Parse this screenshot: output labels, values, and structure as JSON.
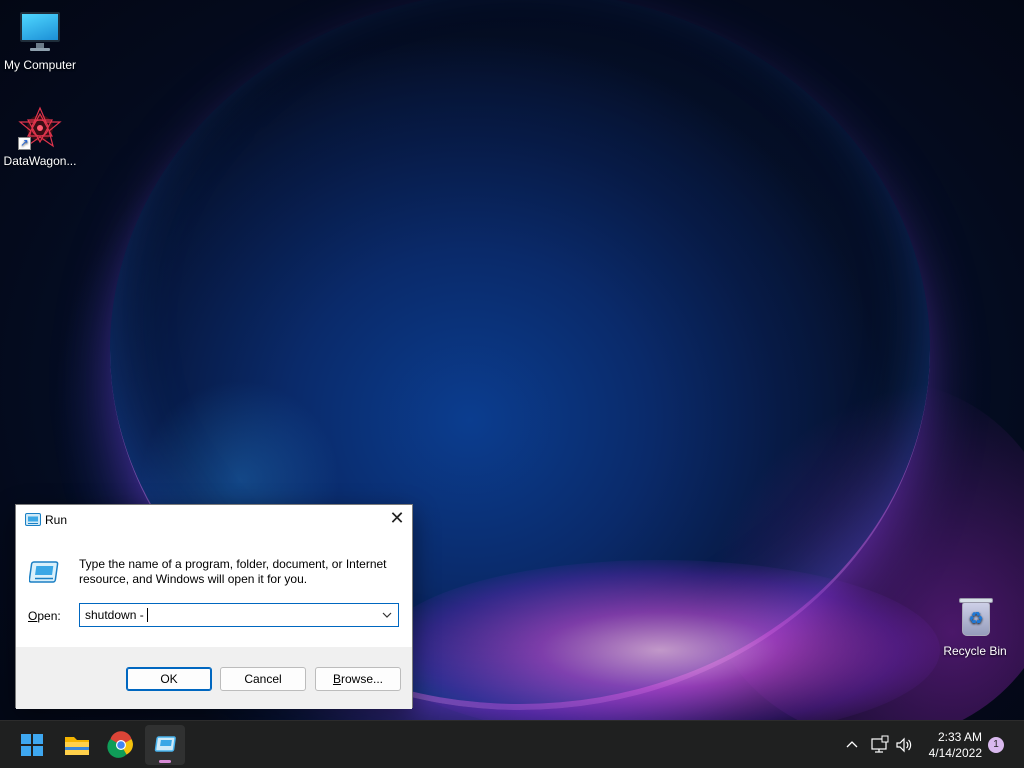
{
  "desktop": {
    "icons": [
      {
        "label": "My Computer"
      },
      {
        "label": "DataWagon..."
      },
      {
        "label": "Recycle Bin"
      }
    ]
  },
  "run_dialog": {
    "title": "Run",
    "description": "Type the name of a program, folder, document, or Internet resource, and Windows will open it for you.",
    "open_label_u": "O",
    "open_label_rest": "pen:",
    "input_value": "shutdown -",
    "ok_label": "OK",
    "cancel_label": "Cancel",
    "browse_label_u": "B",
    "browse_label_rest": "rowse...",
    "close_glyph": "✕"
  },
  "taskbar": {
    "apps": [
      {
        "name": "Start"
      },
      {
        "name": "File Explorer"
      },
      {
        "name": "Google Chrome"
      },
      {
        "name": "Run"
      }
    ],
    "clock": {
      "time": "2:33 AM",
      "date": "4/14/2022"
    },
    "notification_count": "1"
  },
  "colors": {
    "accent": "#0067c0",
    "taskbar_bg": "#1f2020",
    "dialog_footer": "#f0f0f0"
  }
}
